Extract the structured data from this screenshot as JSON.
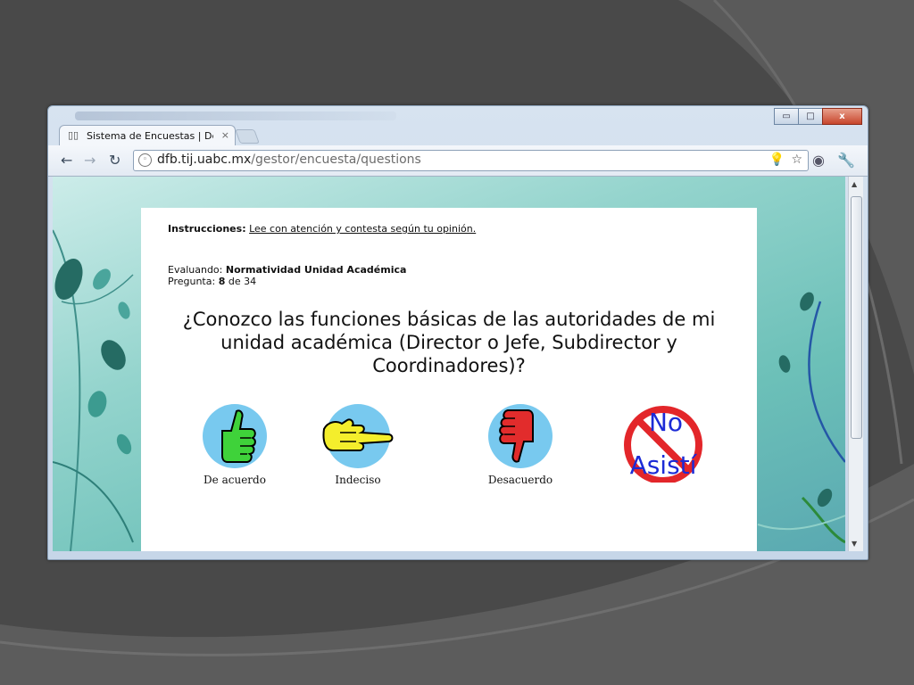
{
  "browser": {
    "tab_icon": "page-icon",
    "tab_title": "Sistema de Encuestas | Depa",
    "tab_close": "×",
    "url_domain": "dfb.tij.uabc.mx",
    "url_path": "/gestor/encuesta/questions",
    "window_buttons": {
      "minimize": "▭",
      "maximize": "□",
      "close": "x"
    }
  },
  "survey": {
    "instructions_label": "Instrucciones:",
    "instructions_text": "Lee con atención y contesta según tu opinión.",
    "evaluating_label": "Evaluando:",
    "evaluating_value": "Normatividad Unidad Académica",
    "question_label": "Pregunta:",
    "question_current": "8",
    "question_sep": "de",
    "question_total": "34",
    "question_text": "¿Conozco las funciones básicas de las autoridades de mi unidad académica (Director o Jefe, Subdirector y Coordinadores)?",
    "options": [
      {
        "label": "De acuerdo",
        "icon": "thumbs-up-icon",
        "color": "#3fd23a"
      },
      {
        "label": "Indeciso",
        "icon": "thumb-sideways-icon",
        "color": "#f4ee2c"
      },
      {
        "label": "Desacuerdo",
        "icon": "thumbs-down-icon",
        "color": "#e22c2c"
      },
      {
        "label": "No Asistí",
        "icon": "no-symbol-icon",
        "color": "#e3262a"
      }
    ]
  }
}
